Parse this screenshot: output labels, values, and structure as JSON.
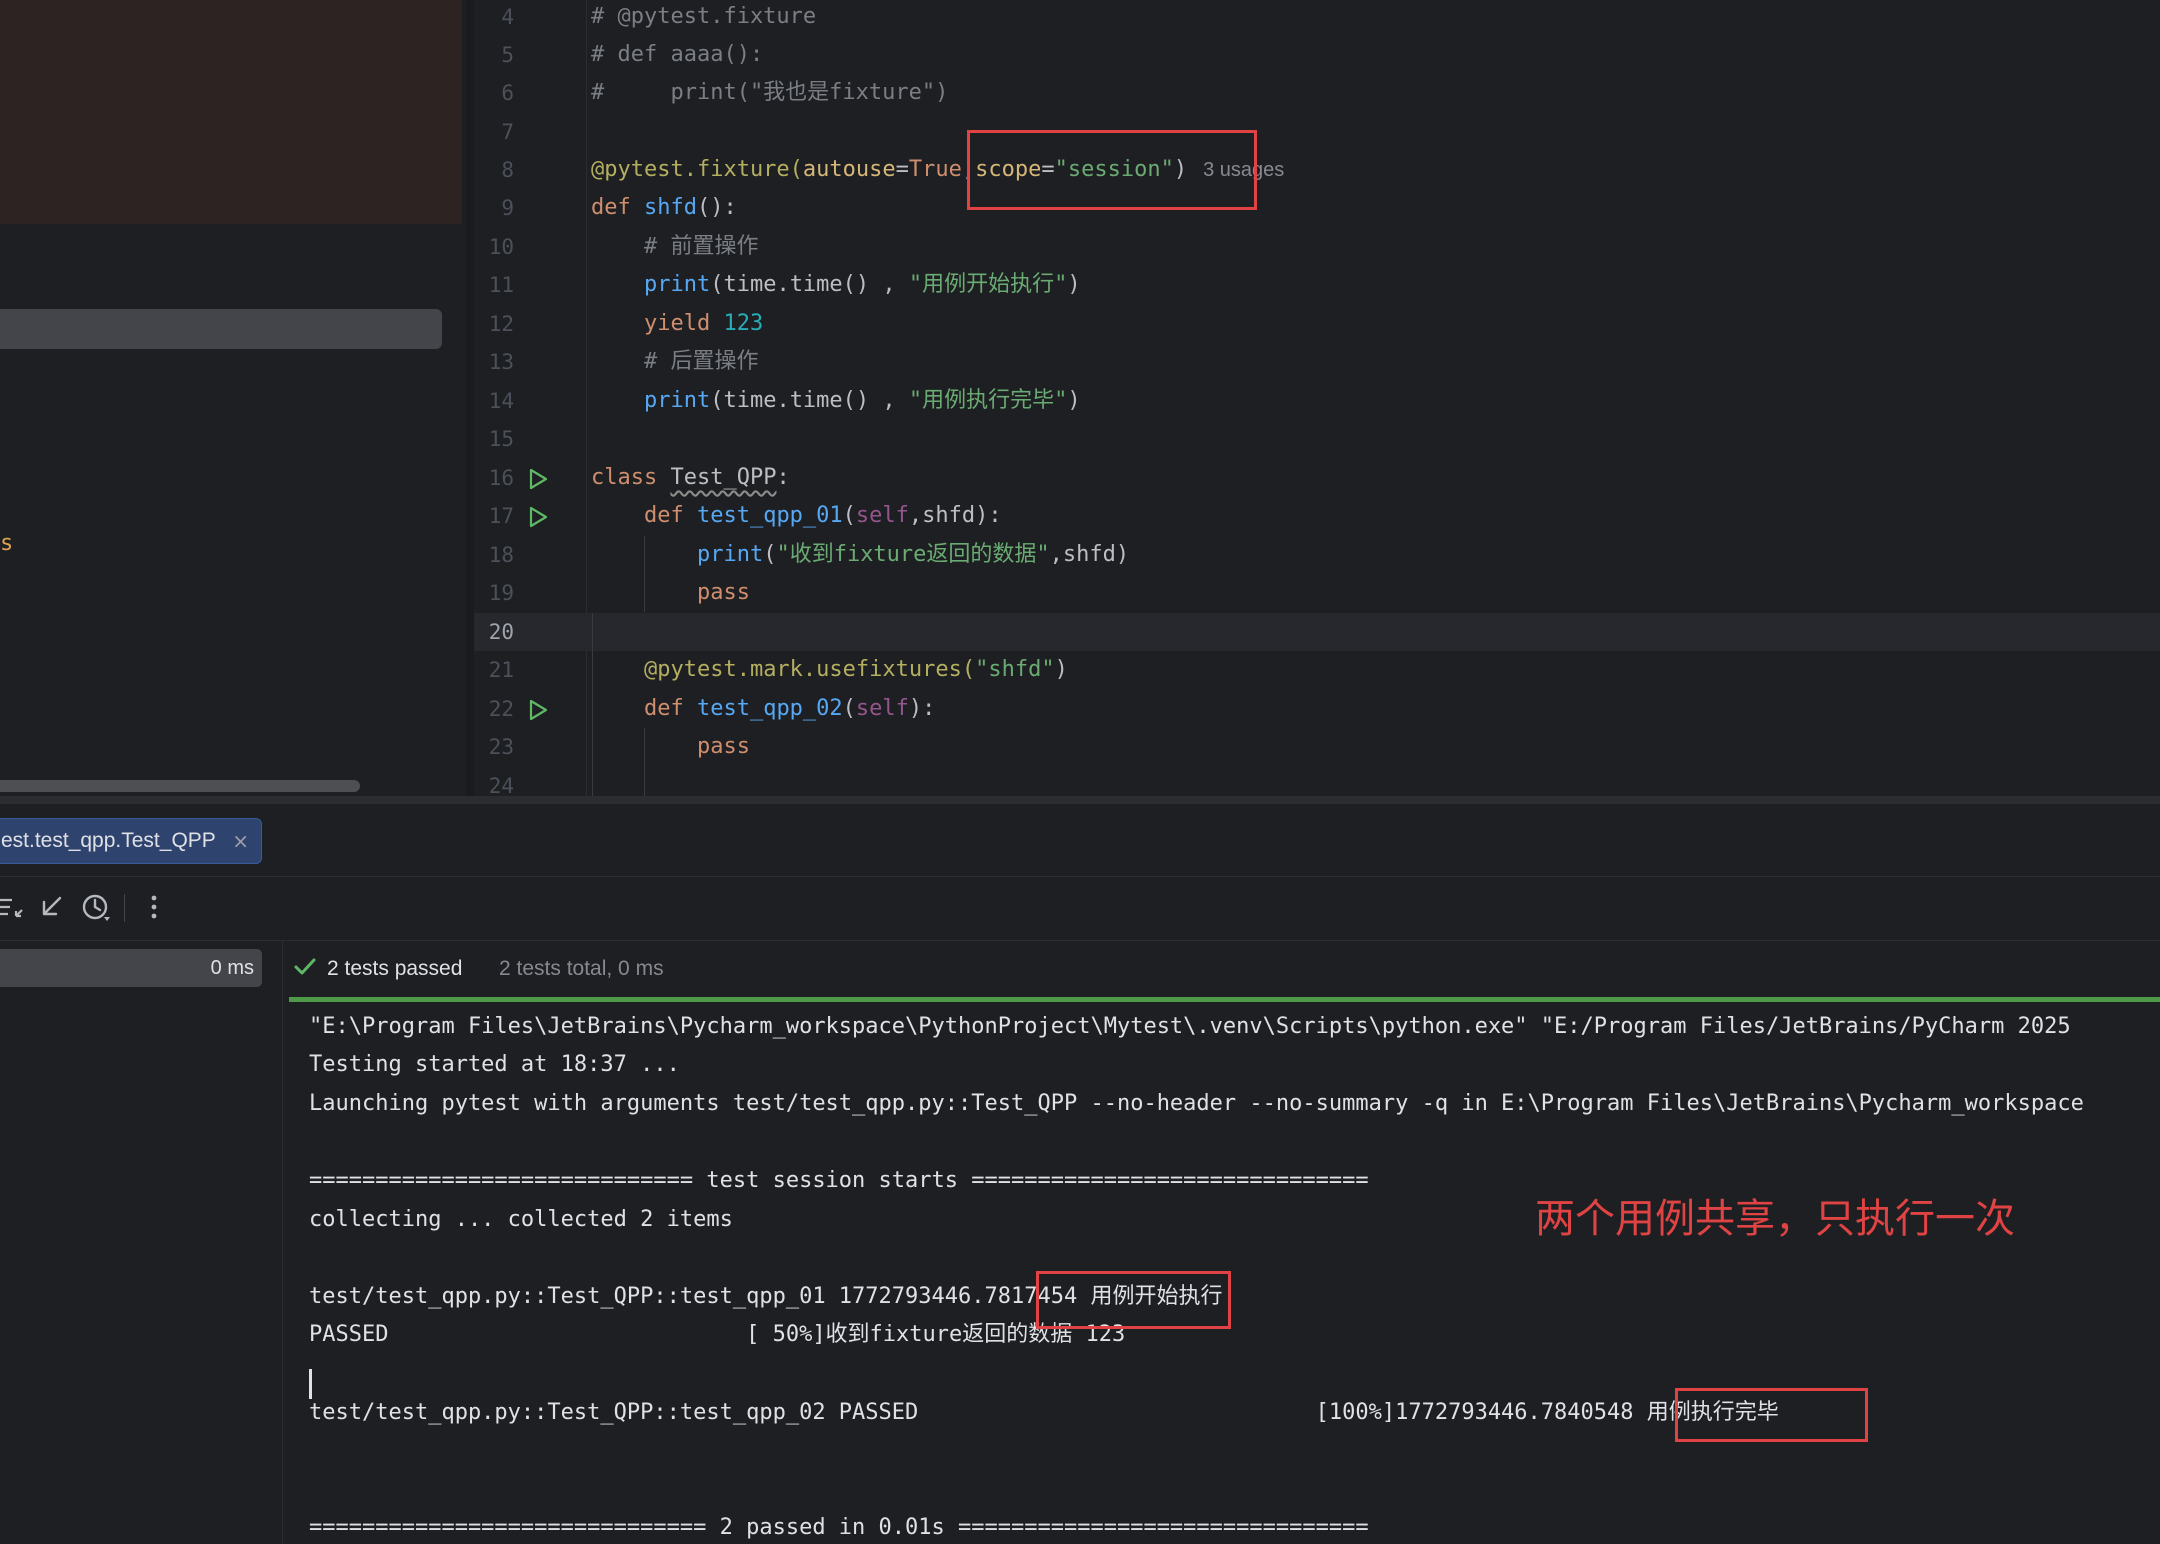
{
  "editor": {
    "lines": [
      {
        "num": "4",
        "text": "# @pytest.fixture"
      },
      {
        "num": "5",
        "text": "# def aaaa():"
      },
      {
        "num": "6",
        "text": "#     print(\"我也是fixture\")"
      },
      {
        "num": "7",
        "text": ""
      },
      {
        "num": "8",
        "decorator": "@pytest.fixture(",
        "p1": "autouse",
        "eq": "=",
        "v1": "True",
        "comma": ",",
        "p2": "scope",
        "v2": "\"session\"",
        "close": ")",
        "hint": "3 usages"
      },
      {
        "num": "9",
        "kw": "def ",
        "name": "shfd",
        "rest": "():"
      },
      {
        "num": "10",
        "text": "    # 前置操作"
      },
      {
        "num": "11",
        "indent": "    ",
        "fn": "print",
        "a": "(time.time() , ",
        "s": "\"用例开始执行\"",
        "b": ")"
      },
      {
        "num": "12",
        "indent": "    ",
        "kw": "yield ",
        "n": "123"
      },
      {
        "num": "13",
        "text": "    # 后置操作"
      },
      {
        "num": "14",
        "indent": "    ",
        "fn": "print",
        "a": "(time.time() , ",
        "s": "\"用例执行完毕\"",
        "b": ")"
      },
      {
        "num": "15",
        "text": ""
      },
      {
        "num": "16",
        "kw": "class ",
        "name": "Test_QPP",
        "rest": ":"
      },
      {
        "num": "17",
        "indent": "    ",
        "kw": "def ",
        "name": "test_qpp_01",
        "a": "(",
        "self": "self",
        "b": ",shfd):"
      },
      {
        "num": "18",
        "indent": "        ",
        "fn": "print",
        "a": "(",
        "s": "\"收到fixture返回的数据\"",
        "b": ",shfd)"
      },
      {
        "num": "19",
        "indent": "        ",
        "kw": "pass"
      },
      {
        "num": "20",
        "text": ""
      },
      {
        "num": "21",
        "indent": "    ",
        "decorator": "@pytest.mark.usefixtures(",
        "s": "\"shfd\"",
        "close": ")"
      },
      {
        "num": "22",
        "indent": "    ",
        "kw": "def ",
        "name": "test_qpp_02",
        "a": "(",
        "self": "self",
        "b": "):"
      },
      {
        "num": "23",
        "indent": "        ",
        "kw": "pass"
      },
      {
        "num": "24",
        "text": ""
      }
    ]
  },
  "run_panel": {
    "tab_label": "est.test_qpp.Test_QPP",
    "tab_close": "×",
    "tree_time": "0 ms",
    "status_passed": "2 tests passed",
    "status_total": "2 tests total, 0 ms",
    "console": [
      "\"E:\\Program Files\\JetBrains\\Pycharm_workspace\\PythonProject\\Mytest\\.venv\\Scripts\\python.exe\" \"E:/Program Files/JetBrains/PyCharm 2025",
      "Testing started at 18:37 ...",
      "Launching pytest with arguments test/test_qpp.py::Test_QPP --no-header --no-summary -q in E:\\Program Files\\JetBrains\\Pycharm_workspace",
      "",
      "============================= test session starts ==============================",
      "collecting ... collected 2 items",
      "",
      "test/test_qpp.py::Test_QPP::test_qpp_01 1772793446.7817454 用例开始执行",
      "PASSED                           [ 50%]收到fixture返回的数据 123",
      "",
      "test/test_qpp.py::Test_QPP::test_qpp_02 PASSED                              [100%]1772793446.7840548 用例执行完毕",
      "",
      "",
      "============================== 2 passed in 0.01s ==============================="
    ],
    "annotation": "两个用例共享，只执行一次"
  },
  "colors": {
    "accent_red": "#e04343",
    "pass_green": "#4e9a48",
    "run_icon_green": "#5fb865"
  }
}
